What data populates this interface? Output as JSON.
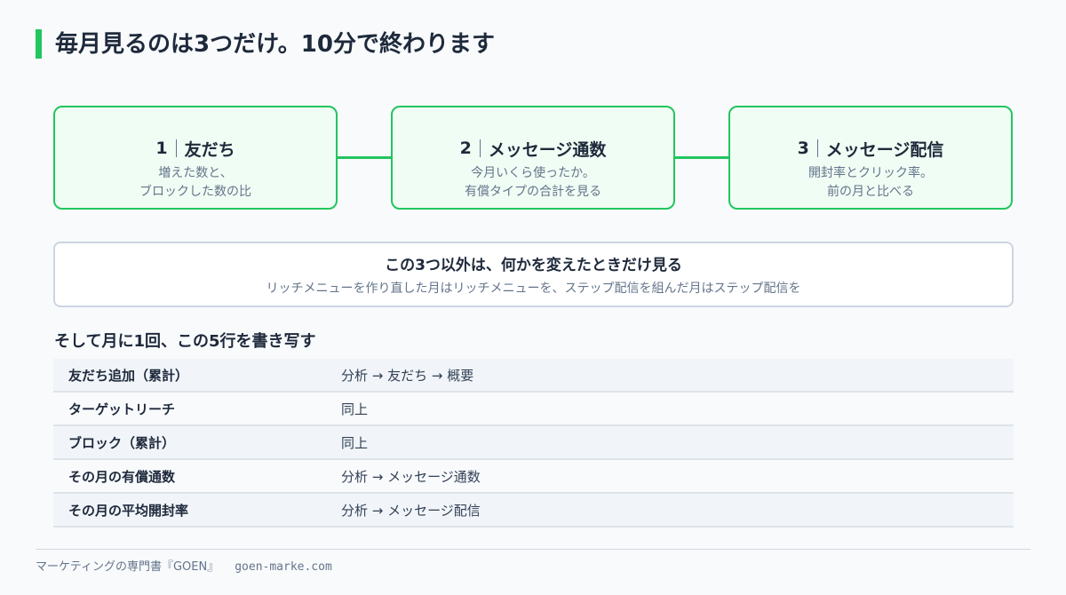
{
  "title": "毎月見るのは3つだけ。10分で終わります",
  "colors": {
    "accent": "#22c55e",
    "card_bg": "#f0fdf4",
    "text": "#1e293b",
    "muted": "#64748b",
    "row_alt": "#f1f5f9"
  },
  "steps": [
    {
      "num": "1",
      "label": "友だち",
      "desc_line1": "増えた数と、",
      "desc_line2": "ブロックした数の比"
    },
    {
      "num": "2",
      "label": "メッセージ通数",
      "desc_line1": "今月いくら使ったか。",
      "desc_line2": "有償タイプの合計を見る"
    },
    {
      "num": "3",
      "label": "メッセージ配信",
      "desc_line1": "開封率とクリック率。",
      "desc_line2": "前の月と比べる"
    }
  ],
  "note": {
    "heading": "この3つ以外は、何かを変えたときだけ見る",
    "sub": "リッチメニューを作り直した月はリッチメニューを、ステップ配信を組んだ月はステップ配信を"
  },
  "table": {
    "title": "そして月に1回、この5行を書き写す",
    "rows": [
      {
        "key": "友だち追加（累計）",
        "value": "分析 → 友だち → 概要"
      },
      {
        "key": "ターゲットリーチ",
        "value": "同上"
      },
      {
        "key": "ブロック（累計）",
        "value": "同上"
      },
      {
        "key": "その月の有償通数",
        "value": "分析 → メッセージ通数"
      },
      {
        "key": "その月の平均開封率",
        "value": "分析 → メッセージ配信"
      }
    ]
  },
  "footer": {
    "brand": "マーケティングの専門書『GOEN』",
    "url": "goen-marke.com"
  }
}
